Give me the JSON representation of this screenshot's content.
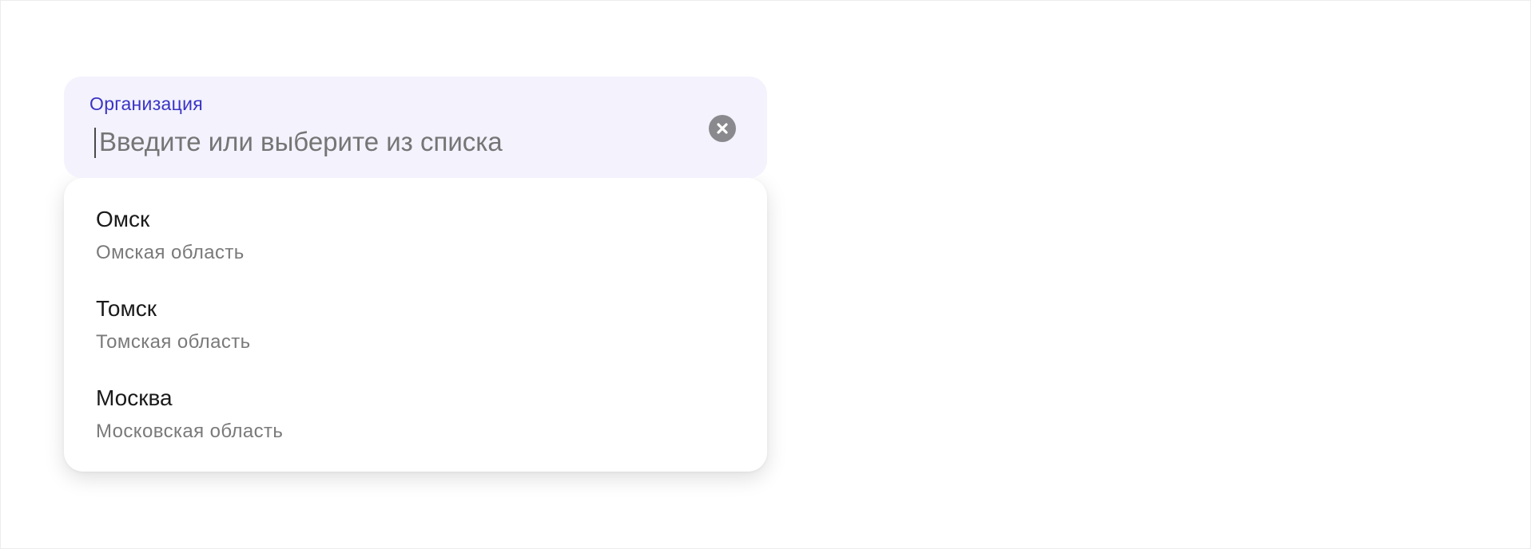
{
  "organization_field": {
    "label": "Организация",
    "placeholder": "Введите или выберите из списка",
    "value": "",
    "clear_icon": "close-circle-icon"
  },
  "dropdown": {
    "options": [
      {
        "title": "Омск",
        "subtitle": "Омская область"
      },
      {
        "title": "Томск",
        "subtitle": "Томская область"
      },
      {
        "title": "Москва",
        "subtitle": "Московская область"
      }
    ]
  },
  "colors": {
    "label_accent": "#3a33c4",
    "field_background": "#f3f2fd",
    "clear_icon": "#8a8a8e",
    "placeholder": "#757575",
    "subtitle": "#7a7a7a"
  }
}
